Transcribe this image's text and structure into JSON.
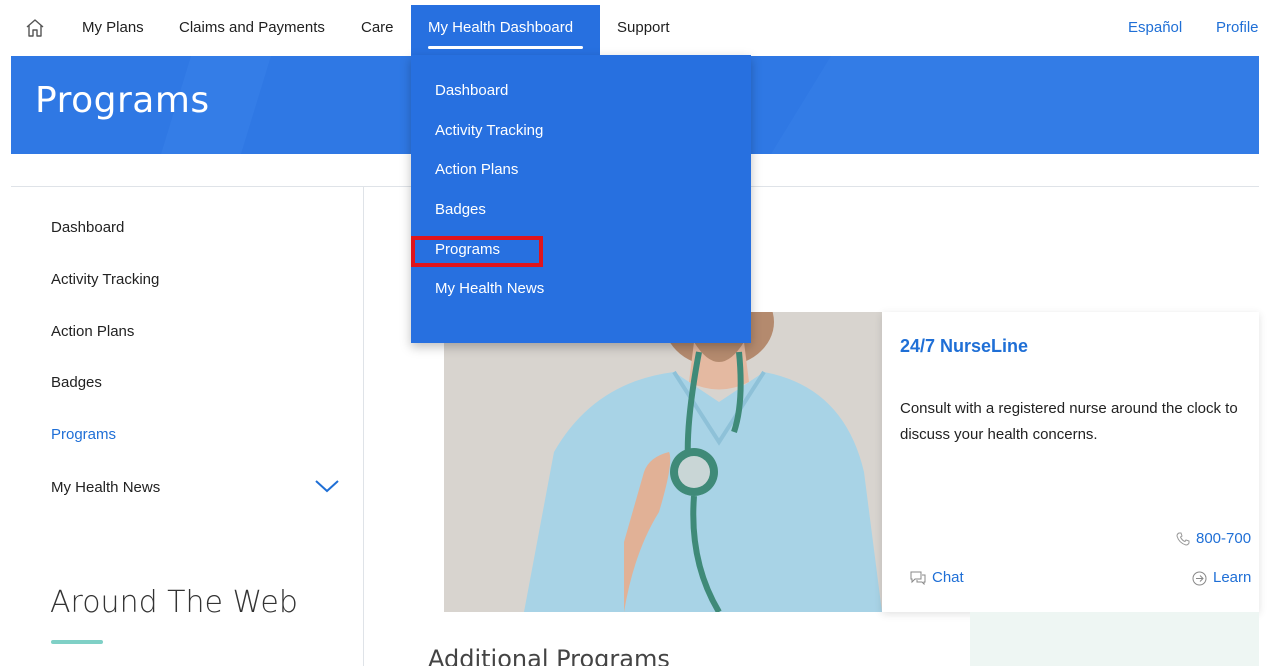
{
  "nav": {
    "items": [
      "My Plans",
      "Claims and Payments",
      "Care"
    ],
    "active": "My Health Dashboard",
    "support": "Support",
    "language": "Español",
    "profile": "Profile"
  },
  "banner": {
    "title": "Programs"
  },
  "dropdown": {
    "items": [
      "Dashboard",
      "Activity Tracking",
      "Action Plans",
      "Badges",
      "Programs",
      "My Health News"
    ]
  },
  "sidebar": {
    "items": [
      "Dashboard",
      "Activity Tracking",
      "Action Plans",
      "Badges",
      "Programs",
      "My Health News"
    ],
    "active": "Programs"
  },
  "around": {
    "title": "Around The Web"
  },
  "card": {
    "title": "24/7 NurseLine",
    "description": "Consult with a registered nurse around the clock to discuss your health concerns.",
    "phone": "800-700",
    "chat": "Chat",
    "learn": "Learn"
  },
  "additional": {
    "title": "Additional Programs"
  },
  "colors": {
    "brand": "#2f78e4",
    "link": "#1f6fd6",
    "highlight": "#e0141c",
    "accent": "#7fd0c6"
  }
}
